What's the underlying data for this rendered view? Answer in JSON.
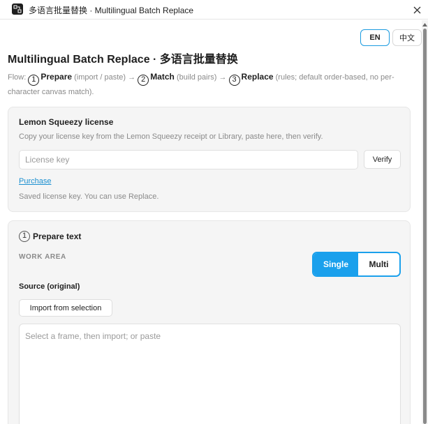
{
  "window": {
    "title": "多语言批量替换 · Multilingual Batch Replace",
    "icon": "app-logo-icon",
    "close_icon": "close-icon"
  },
  "language": {
    "en_label": "EN",
    "zh_label": "中文",
    "active": "EN"
  },
  "page": {
    "title": "Multilingual Batch Replace · 多语言批量替换"
  },
  "flow": {
    "prefix": "Flow:",
    "steps": [
      {
        "num": "1",
        "name": "Prepare",
        "hint": "(import / paste)"
      },
      {
        "num": "2",
        "name": "Match",
        "hint": "(build pairs)"
      },
      {
        "num": "3",
        "name": "Replace",
        "hint": "(rules; default order-based, no per-character canvas match)."
      }
    ],
    "arrow": "→"
  },
  "license": {
    "title": "Lemon Squeezy license",
    "description": "Copy your license key from the Lemon Squeezy receipt or Library, paste here, then verify.",
    "input_placeholder": "License key",
    "input_value": "",
    "verify_label": "Verify",
    "purchase_label": "Purchase",
    "status": "Saved license key. You can use Replace."
  },
  "prepare": {
    "step_num": "1",
    "title": "Prepare text",
    "work_area_label": "WORK AREA",
    "mode_single": "Single",
    "mode_multi": "Multi",
    "mode_selected": "Single",
    "source_label": "Source (original)",
    "import_label": "Import from selection",
    "source_placeholder": "Select a frame, then import; or paste",
    "source_value": ""
  },
  "colors": {
    "accent": "#1aa0ec",
    "link": "#1a8fd0",
    "card_bg": "#f5f5f5",
    "muted_text": "#8a8a8a"
  }
}
